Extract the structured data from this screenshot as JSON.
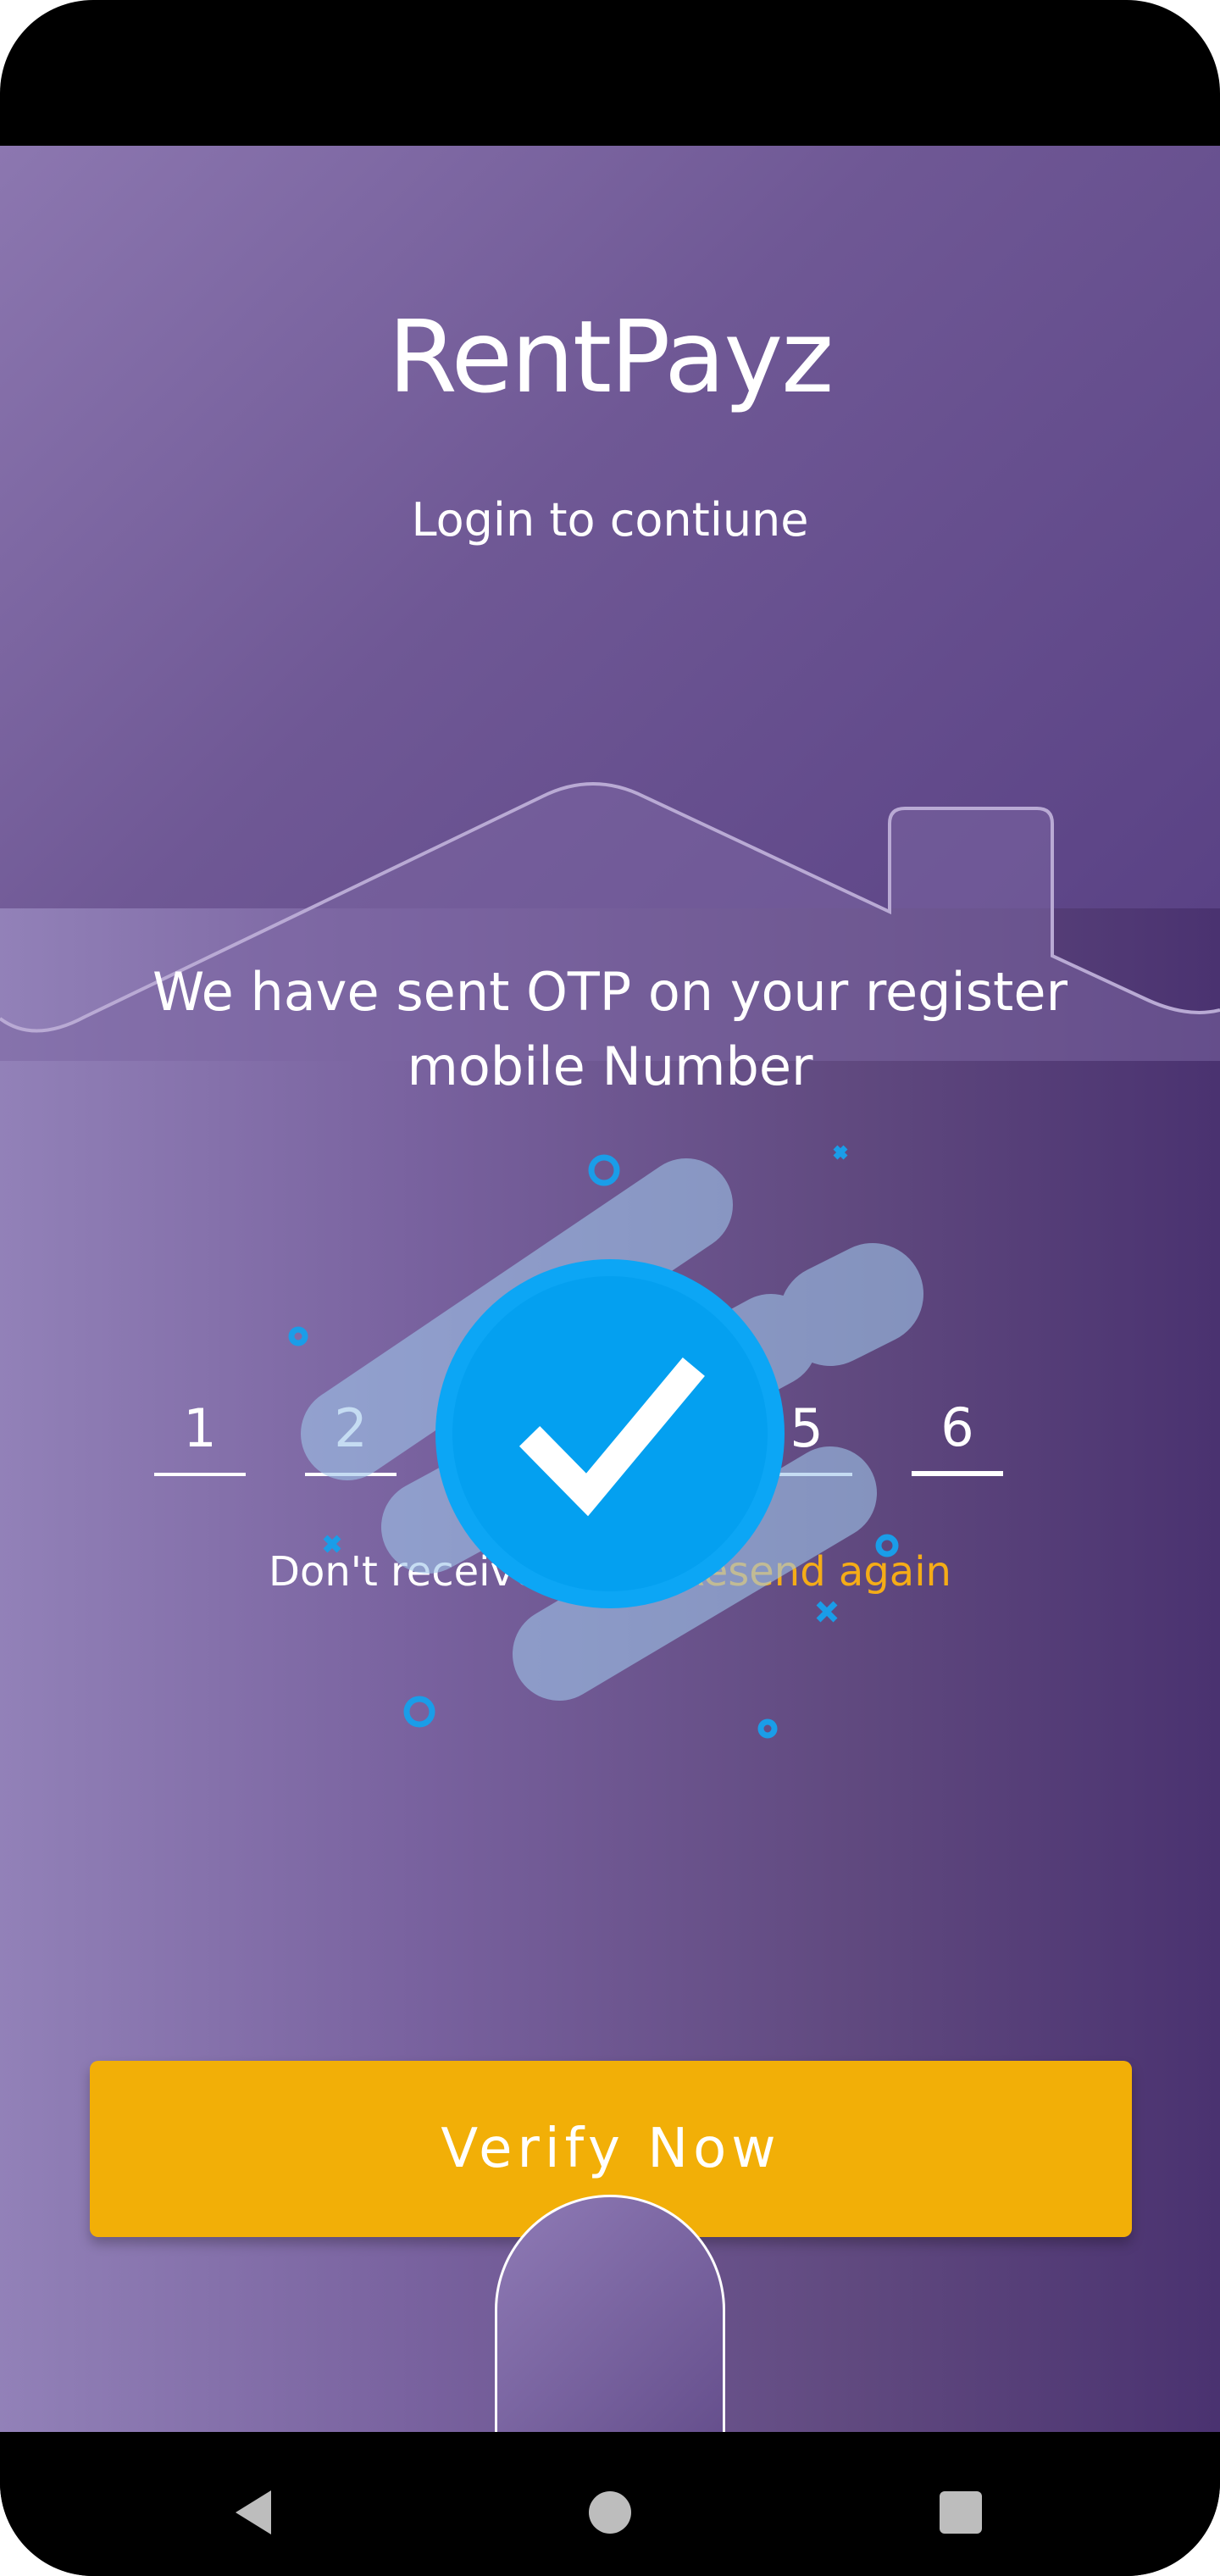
{
  "app": {
    "brand": "RentPayz",
    "subtitle": "Login to contiune"
  },
  "otp": {
    "message": "We have sent OTP on your register mobile Number",
    "digits": [
      "1",
      "2",
      "",
      "",
      "5",
      "6"
    ],
    "resend_prefix": "Don't receive OTP?",
    "resend_link": "Resend again"
  },
  "actions": {
    "verify_label": "Verify Now"
  },
  "navigation": {
    "back_icon": "back-triangle-icon",
    "home_icon": "home-circle-icon",
    "recents_icon": "recents-square-icon"
  },
  "colors": {
    "accent": "#f2af07",
    "link": "#f5ac17",
    "success": "#04a0f0",
    "bg_start": "#9281b8",
    "bg_end": "#4a3270"
  }
}
